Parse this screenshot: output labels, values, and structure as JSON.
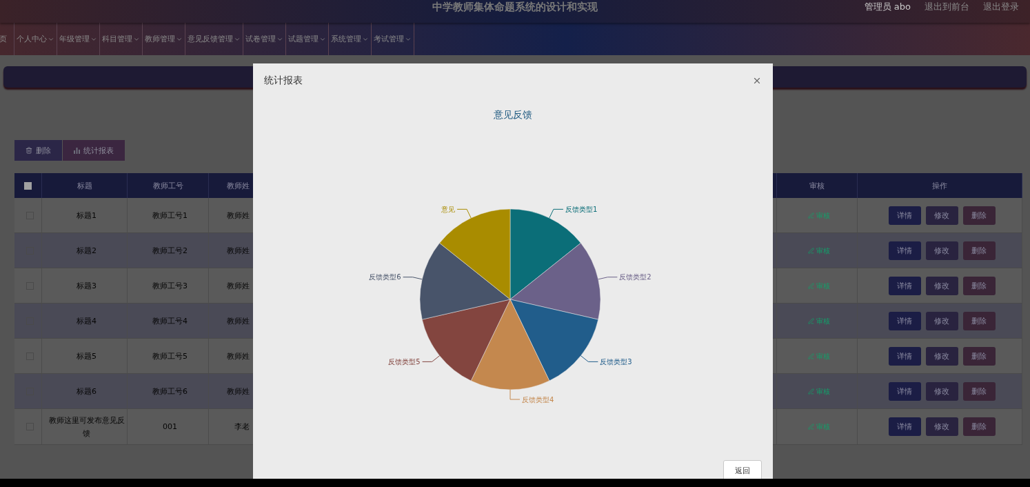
{
  "header": {
    "title": "中学教师集体命题系统的设计和实现",
    "user": "管理员 abo",
    "links": [
      "退出到前台",
      "退出登录"
    ]
  },
  "nav": [
    {
      "label": "页",
      "has_menu": false
    },
    {
      "label": "个人中心",
      "has_menu": true
    },
    {
      "label": "年级管理",
      "has_menu": true
    },
    {
      "label": "科目管理",
      "has_menu": true
    },
    {
      "label": "教师管理",
      "has_menu": true
    },
    {
      "label": "意见反馈管理",
      "has_menu": true
    },
    {
      "label": "试卷管理",
      "has_menu": true
    },
    {
      "label": "试题管理",
      "has_menu": true
    },
    {
      "label": "系统管理",
      "has_menu": true
    },
    {
      "label": "考试管理",
      "has_menu": true
    }
  ],
  "toolbar": [
    {
      "label": "删除",
      "kind": "delete"
    },
    {
      "label": "统计报表",
      "kind": "report"
    }
  ],
  "table": {
    "select_all": {
      "checked": false
    },
    "columns": [
      "标题",
      "教师工号",
      "教师姓",
      "审核",
      "操作"
    ],
    "rows": [
      {
        "checked": false,
        "title": "标题1",
        "teacher_id": "教师工号1",
        "teacher_name": "教师姓",
        "review": "审核",
        "actions": [
          "详情",
          "修改",
          "删除"
        ]
      },
      {
        "checked": false,
        "title": "标题2",
        "teacher_id": "教师工号2",
        "teacher_name": "教师姓",
        "review": "审核",
        "actions": [
          "详情",
          "修改",
          "删除"
        ]
      },
      {
        "checked": false,
        "title": "标题3",
        "teacher_id": "教师工号3",
        "teacher_name": "教师姓",
        "review": "审核",
        "actions": [
          "详情",
          "修改",
          "删除"
        ]
      },
      {
        "checked": false,
        "title": "标题4",
        "teacher_id": "教师工号4",
        "teacher_name": "教师姓",
        "review": "审核",
        "actions": [
          "详情",
          "修改",
          "删除"
        ]
      },
      {
        "checked": false,
        "title": "标题5",
        "teacher_id": "教师工号5",
        "teacher_name": "教师姓",
        "review": "审核",
        "actions": [
          "详情",
          "修改",
          "删除"
        ]
      },
      {
        "checked": false,
        "title": "标题6",
        "teacher_id": "教师工号6",
        "teacher_name": "教师姓",
        "review": "审核",
        "actions": [
          "详情",
          "修改",
          "删除"
        ]
      },
      {
        "checked": false,
        "title": "教师这里可发布意见反馈",
        "teacher_id": "001",
        "teacher_name": "李老",
        "review": "审核",
        "actions": [
          "详情",
          "修改",
          "删除"
        ]
      }
    ]
  },
  "modal": {
    "title": "统计报表",
    "button": "返回",
    "chart_data": {
      "type": "pie",
      "title": "意见反馈",
      "categories": [
        "反馈类型1",
        "反馈类型2",
        "反馈类型3",
        "反馈类型4",
        "反馈类型5",
        "反馈类型6",
        "意见"
      ],
      "values": [
        1,
        1,
        1,
        1,
        1,
        1,
        1
      ],
      "colors": [
        "#0b6e78",
        "#6b6189",
        "#215d8b",
        "#c4884e",
        "#83453f",
        "#48546a",
        "#a98c00"
      ]
    }
  }
}
